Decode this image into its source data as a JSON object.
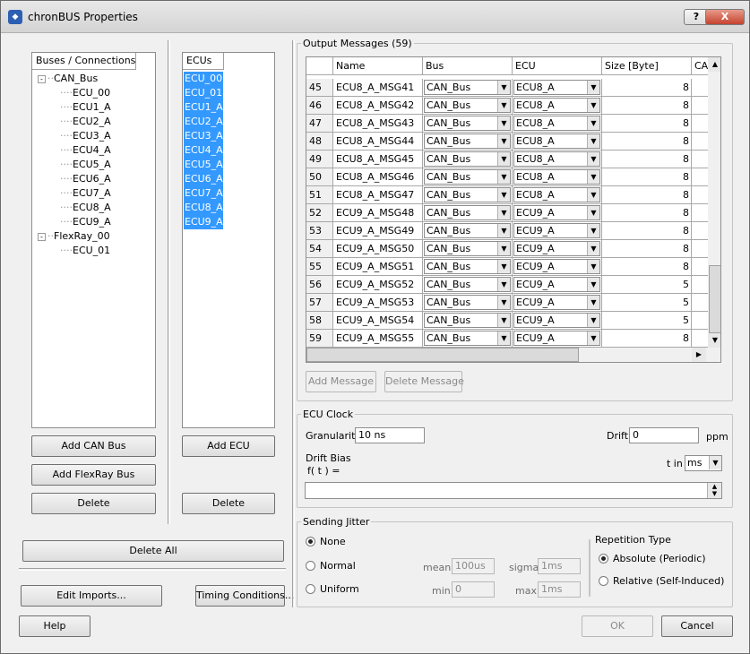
{
  "window": {
    "title": "chronBUS Properties",
    "help_btn": "?",
    "close_btn": "X"
  },
  "buses": {
    "header": "Buses / Connections",
    "tree": [
      {
        "label": "CAN_Bus",
        "children": [
          "ECU_00",
          "ECU1_A",
          "ECU2_A",
          "ECU3_A",
          "ECU4_A",
          "ECU5_A",
          "ECU6_A",
          "ECU7_A",
          "ECU8_A",
          "ECU9_A"
        ]
      },
      {
        "label": "FlexRay_00",
        "children": [
          "ECU_01"
        ]
      }
    ],
    "add_can": "Add CAN Bus",
    "add_flexray": "Add FlexRay Bus",
    "delete": "Delete"
  },
  "ecus": {
    "header": "ECUs",
    "items": [
      "ECU_00",
      "ECU_01",
      "ECU1_A",
      "ECU2_A",
      "ECU3_A",
      "ECU4_A",
      "ECU5_A",
      "ECU6_A",
      "ECU7_A",
      "ECU8_A",
      "ECU9_A"
    ],
    "add": "Add ECU",
    "delete": "Delete"
  },
  "delete_all": "Delete All",
  "edit_imports": "Edit Imports...",
  "timing_conditions": "Timing Conditions...",
  "help": "Help",
  "ok": "OK",
  "cancel": "Cancel",
  "output": {
    "title": "Output Messages (59)",
    "columns": [
      "Name",
      "Bus",
      "ECU",
      "Size [Byte]",
      "CA"
    ],
    "rows": [
      {
        "n": "45",
        "name": "ECU8_A_MSG41",
        "bus": "CAN_Bus",
        "ecu": "ECU8_A",
        "size": "8"
      },
      {
        "n": "46",
        "name": "ECU8_A_MSG42",
        "bus": "CAN_Bus",
        "ecu": "ECU8_A",
        "size": "8"
      },
      {
        "n": "47",
        "name": "ECU8_A_MSG43",
        "bus": "CAN_Bus",
        "ecu": "ECU8_A",
        "size": "8"
      },
      {
        "n": "48",
        "name": "ECU8_A_MSG44",
        "bus": "CAN_Bus",
        "ecu": "ECU8_A",
        "size": "8"
      },
      {
        "n": "49",
        "name": "ECU8_A_MSG45",
        "bus": "CAN_Bus",
        "ecu": "ECU8_A",
        "size": "8"
      },
      {
        "n": "50",
        "name": "ECU8_A_MSG46",
        "bus": "CAN_Bus",
        "ecu": "ECU8_A",
        "size": "8"
      },
      {
        "n": "51",
        "name": "ECU8_A_MSG47",
        "bus": "CAN_Bus",
        "ecu": "ECU8_A",
        "size": "8"
      },
      {
        "n": "52",
        "name": "ECU9_A_MSG48",
        "bus": "CAN_Bus",
        "ecu": "ECU9_A",
        "size": "8"
      },
      {
        "n": "53",
        "name": "ECU9_A_MSG49",
        "bus": "CAN_Bus",
        "ecu": "ECU9_A",
        "size": "8"
      },
      {
        "n": "54",
        "name": "ECU9_A_MSG50",
        "bus": "CAN_Bus",
        "ecu": "ECU9_A",
        "size": "8"
      },
      {
        "n": "55",
        "name": "ECU9_A_MSG51",
        "bus": "CAN_Bus",
        "ecu": "ECU9_A",
        "size": "8"
      },
      {
        "n": "56",
        "name": "ECU9_A_MSG52",
        "bus": "CAN_Bus",
        "ecu": "ECU9_A",
        "size": "5"
      },
      {
        "n": "57",
        "name": "ECU9_A_MSG53",
        "bus": "CAN_Bus",
        "ecu": "ECU9_A",
        "size": "5"
      },
      {
        "n": "58",
        "name": "ECU9_A_MSG54",
        "bus": "CAN_Bus",
        "ecu": "ECU9_A",
        "size": "5"
      },
      {
        "n": "59",
        "name": "ECU9_A_MSG55",
        "bus": "CAN_Bus",
        "ecu": "ECU9_A",
        "size": "8"
      }
    ],
    "add_message": "Add Message",
    "delete_message": "Delete Message"
  },
  "clock": {
    "title": "ECU Clock",
    "granularity_label": "Granularity",
    "granularity_value": "10 ns",
    "drift_label": "Drift",
    "drift_value": "0",
    "drift_unit": "ppm",
    "bias_label": "Drift Bias",
    "bias_fn": "f( t ) =",
    "tin_label": "t in",
    "tin_value": "ms",
    "bias_value": ""
  },
  "jitter": {
    "title": "Sending Jitter",
    "none": "None",
    "normal": "Normal",
    "uniform": "Uniform",
    "mean_label": "mean",
    "mean_value": "100us",
    "sigma_label": "sigma",
    "sigma_value": "1ms",
    "min_label": "min",
    "min_value": "0",
    "max_label": "max",
    "max_value": "1ms"
  },
  "repetition": {
    "title": "Repetition Type",
    "absolute": "Absolute (Periodic)",
    "relative": "Relative (Self-Induced)"
  }
}
